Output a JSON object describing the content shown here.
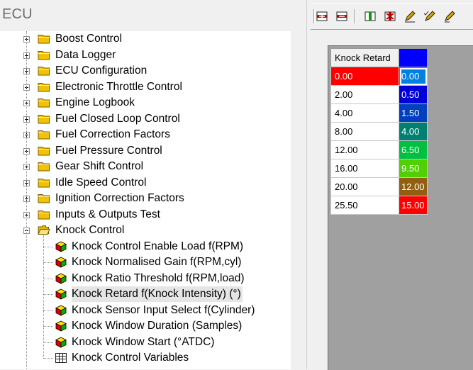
{
  "panel": {
    "title": "ECU"
  },
  "tree": {
    "top_folders": [
      "Boost Control",
      "Data Logger",
      "ECU Configuration",
      "Electronic Throttle Control",
      "Engine Logbook",
      "Fuel Closed Loop Control",
      "Fuel Correction Factors",
      "Fuel Pressure Control",
      "Gear Shift Control",
      "Idle Speed Control",
      "Ignition Correction Factors",
      "Inputs & Outputs Test"
    ],
    "expanded_folder": "Knock Control",
    "children": [
      {
        "label": "Knock Control Enable Load f(RPM)",
        "icon": "cube-icon"
      },
      {
        "label": "Knock Normalised Gain f(RPM,cyl)",
        "icon": "cube-icon"
      },
      {
        "label": "Knock Ratio Threshold f(RPM,load)",
        "icon": "cube-icon"
      },
      {
        "label": "Knock Retard f(Knock Intensity) (°)",
        "icon": "cube-icon",
        "selected": true
      },
      {
        "label": "Knock Sensor Input Select f(Cylinder)",
        "icon": "cube-icon"
      },
      {
        "label": "Knock Window Duration (Samples)",
        "icon": "cube-icon"
      },
      {
        "label": "Knock Window Start (°ATDC)",
        "icon": "cube-icon"
      },
      {
        "label": "Knock Control Variables",
        "icon": "table-grid-icon"
      }
    ]
  },
  "toolbar": {
    "buttons": [
      {
        "name": "insert-row-icon",
        "color": "#c00000"
      },
      {
        "name": "delete-row-icon",
        "color": "#c00000"
      },
      {
        "name": "insert-column-icon",
        "color": "#00a000"
      },
      {
        "name": "delete-column-icon",
        "color": "#c00000"
      },
      {
        "name": "edit-pencil-icon",
        "color": "#e0a000"
      },
      {
        "name": "edit-pencil-check-icon",
        "color": "#e0a000"
      },
      {
        "name": "edit-pencil-more-icon",
        "color": "#e0a000"
      }
    ]
  },
  "table": {
    "header": "Knock Retard",
    "header_color": "#0000ff",
    "rows": [
      {
        "axis": "0.00",
        "value": "0.00",
        "color": "#0080e0",
        "selected": true
      },
      {
        "axis": "2.00",
        "value": "0.50",
        "color": "#0000d8"
      },
      {
        "axis": "4.00",
        "value": "1.50",
        "color": "#0040c0"
      },
      {
        "axis": "8.00",
        "value": "4.00",
        "color": "#008070"
      },
      {
        "axis": "12.00",
        "value": "6.50",
        "color": "#00c040"
      },
      {
        "axis": "16.00",
        "value": "9.50",
        "color": "#50d000"
      },
      {
        "axis": "20.00",
        "value": "12.00",
        "color": "#906010"
      },
      {
        "axis": "25.50",
        "value": "15.00",
        "color": "#ff0000"
      }
    ]
  }
}
